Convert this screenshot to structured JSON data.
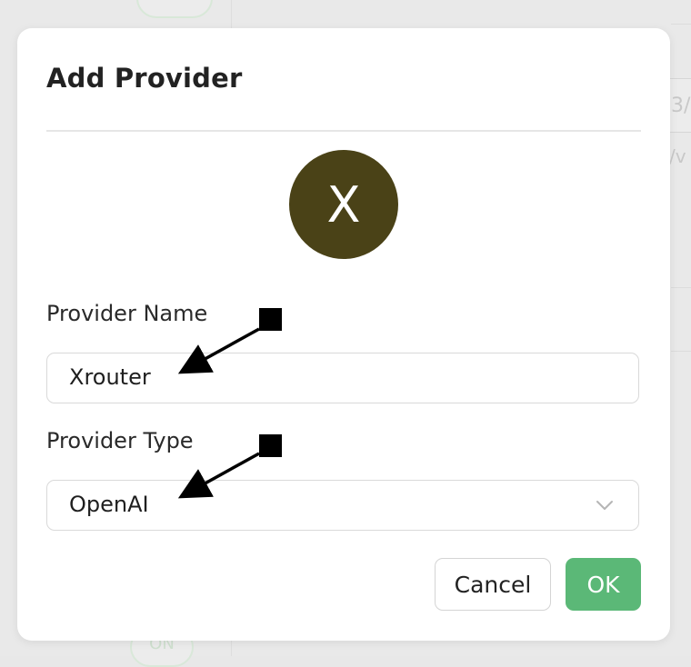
{
  "background": {
    "ghost_text_1": "3/",
    "ghost_text_2": "/v",
    "toggle_label": "ON"
  },
  "dialog": {
    "title": "Add Provider",
    "avatar_letter": "X",
    "avatar_color": "#4a4217",
    "provider_name": {
      "label": "Provider Name",
      "value": "Xrouter"
    },
    "provider_type": {
      "label": "Provider Type",
      "selected": "OpenAI"
    },
    "buttons": {
      "cancel": "Cancel",
      "ok": "OK"
    },
    "ok_color": "#5bb877"
  }
}
